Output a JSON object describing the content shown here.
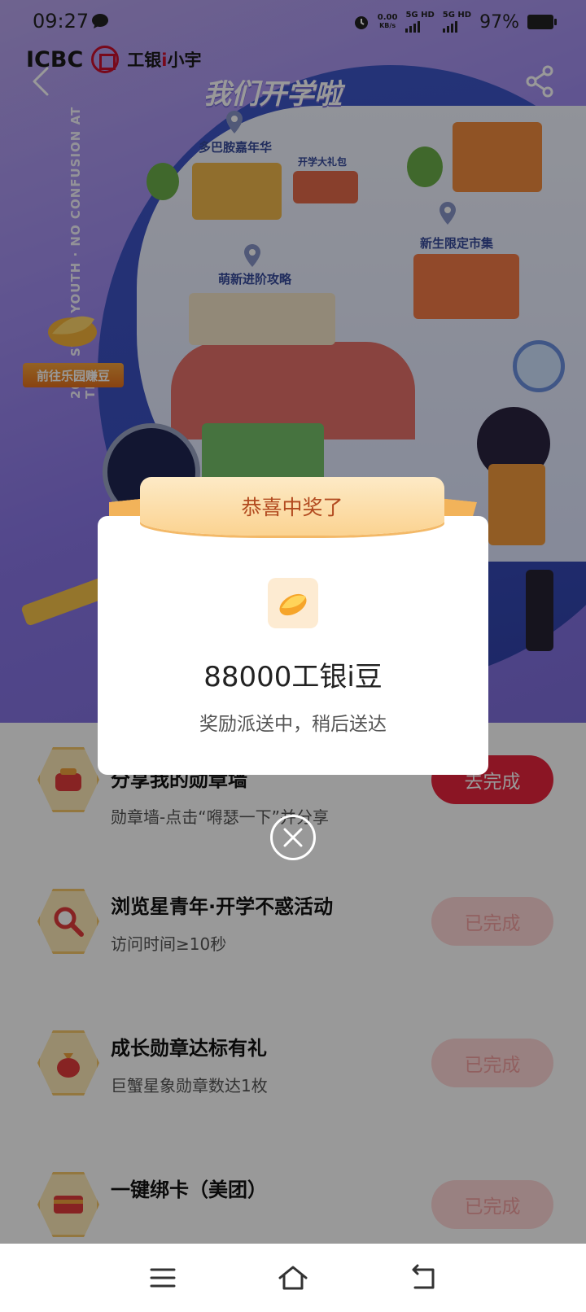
{
  "status_bar": {
    "time": "09:27",
    "net_speed_value": "0.00",
    "net_speed_unit": "KB/s",
    "sim1_label": "5G HD",
    "sim2_label": "5G HD",
    "battery_text": "97%"
  },
  "brand": {
    "bank": "ICBC",
    "product_prefix": "工银",
    "product_i": "i",
    "product_suffix": "小宇"
  },
  "hero": {
    "title": "我们开学啦",
    "ring_text": "2025 STAR YOUTH · NO CONFUSION AT THE",
    "map_labels": [
      "多巴胺嘉年华",
      "开学大礼包",
      "新生限定市集",
      "萌新进阶攻略"
    ],
    "earn_button": "前往乐园赚豆"
  },
  "tasks": [
    {
      "title": "分享我的勋章墙",
      "desc": "勋章墙-点击“嘚瑟一下”并分享",
      "button": "去完成",
      "state": "todo"
    },
    {
      "title": "浏览星青年·开学不惑活动",
      "desc": "访问时间≥10秒",
      "button": "已完成",
      "state": "done"
    },
    {
      "title": "成长勋章达标有礼",
      "desc": "巨蟹星象勋章数达1枚",
      "button": "已完成",
      "state": "done"
    },
    {
      "title": "一键绑卡（美团）",
      "desc": "",
      "button": "已完成",
      "state": "done"
    }
  ],
  "dialog": {
    "ribbon_title": "恭喜中奖了",
    "prize_amount": "88000工银i豆",
    "prize_note": "奖励派送中，稍后送达"
  },
  "colors": {
    "accent_red": "#e8233d",
    "ribbon_gold": "#fbd391",
    "ribbon_text": "#b24a1f",
    "done_button": "#ffd8d8"
  },
  "icons": {
    "task_0": "wallet-icon",
    "task_1": "magnifier-icon",
    "task_2": "money-bag-icon",
    "task_3": "card-icon",
    "prize": "bean-icon"
  }
}
